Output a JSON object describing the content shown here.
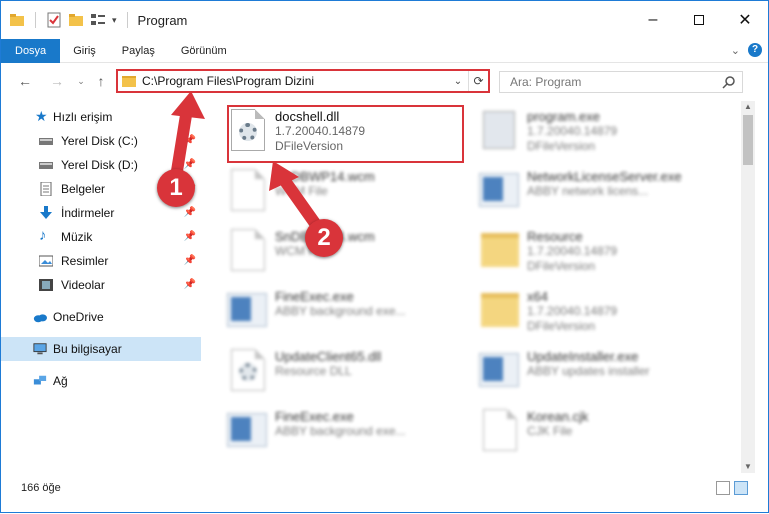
{
  "window": {
    "title": "Program"
  },
  "ribbon": {
    "tabs": [
      "Dosya",
      "Giriş",
      "Paylaş",
      "Görünüm"
    ]
  },
  "address": {
    "path": "C:\\Program Files\\Program Dizini"
  },
  "search": {
    "placeholder": "Ara: Program"
  },
  "sidebar": {
    "items": [
      {
        "label": "Hızlı erişim",
        "icon": "star-icon"
      },
      {
        "label": "Yerel Disk (C:)",
        "icon": "drive-icon"
      },
      {
        "label": "Yerel Disk (D:)",
        "icon": "drive-icon"
      },
      {
        "label": "Belgeler",
        "icon": "documents-icon"
      },
      {
        "label": "İndirmeler",
        "icon": "download-icon"
      },
      {
        "label": "Müzik",
        "icon": "music-icon"
      },
      {
        "label": "Resimler",
        "icon": "pictures-icon"
      },
      {
        "label": "Videolar",
        "icon": "videos-icon"
      },
      {
        "label": "OneDrive",
        "icon": "cloud-icon"
      },
      {
        "label": "Bu bilgisayar",
        "icon": "computer-icon"
      },
      {
        "label": "Ağ",
        "icon": "network-icon"
      }
    ]
  },
  "files": [
    {
      "name": "docshell.dll",
      "sub1": "1.7.20040.14879",
      "sub2": "DFileVersion",
      "type": "dll"
    },
    {
      "name": "program.exe",
      "sub1": "1.7.20040.14879",
      "sub2": "DFileVersion",
      "type": "prog"
    },
    {
      "name": "SnDBWP14.wcm",
      "sub1": "WCM File",
      "type": "doc"
    },
    {
      "name": "NetworkLicenseServer.exe",
      "sub1": "ABBY network licens...",
      "type": "exe"
    },
    {
      "name": "SnDBWP14.wcm",
      "sub1": "WCM File",
      "type": "doc"
    },
    {
      "name": "Resource",
      "sub1": "1.7.20040.14879",
      "sub2": "DFileVersion",
      "type": "folder"
    },
    {
      "name": "FineExec.exe",
      "sub1": "ABBY background exe...",
      "type": "exe"
    },
    {
      "name": "x64",
      "sub1": "1.7.20040.14879",
      "sub2": "DFileVersion",
      "type": "folder"
    },
    {
      "name": "UpdateClient65.dll",
      "sub1": "Resource DLL",
      "type": "dll"
    },
    {
      "name": "UpdateInstaller.exe",
      "sub1": "ABBY updates installer",
      "type": "exe"
    },
    {
      "name": "FineExec.exe",
      "sub1": "ABBY background exe...",
      "type": "exe"
    },
    {
      "name": "Korean.cjk",
      "sub1": "CJK File",
      "type": "doc"
    }
  ],
  "status": {
    "count": "166 öğe"
  },
  "callouts": [
    "1",
    "2"
  ],
  "colors": {
    "accent": "#1979ca",
    "highlight": "#d9343a",
    "selected": "#cce4f7"
  }
}
